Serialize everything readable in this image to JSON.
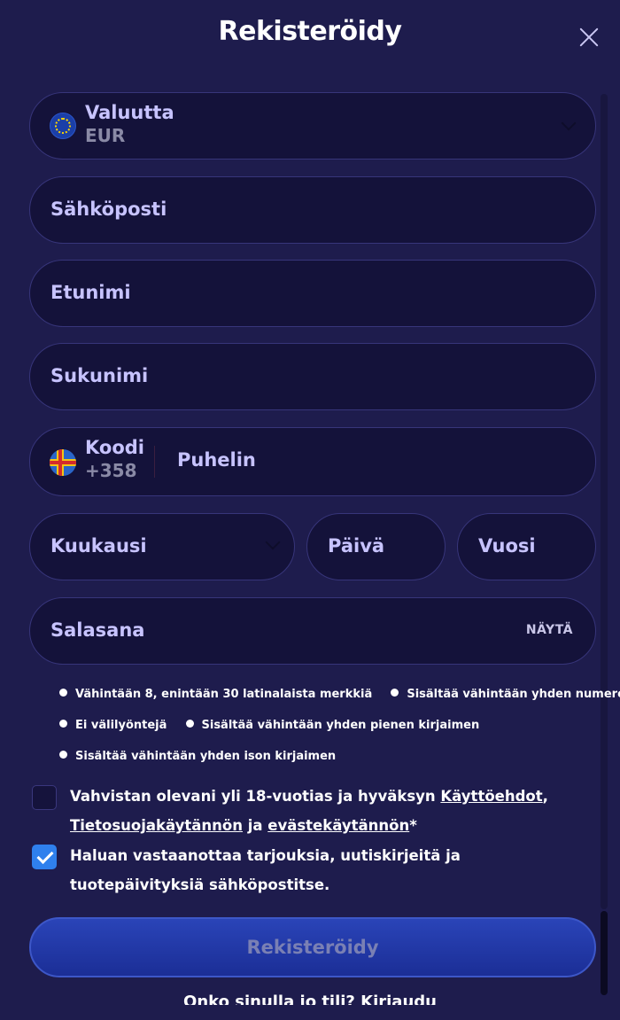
{
  "modal": {
    "title": "Rekisteröidy",
    "close_icon": "close-icon"
  },
  "currency": {
    "label": "Valuutta",
    "value": "EUR",
    "flag_icon": "eu-flag-icon"
  },
  "email": {
    "placeholder": "Sähköposti"
  },
  "first_name": {
    "placeholder": "Etunimi"
  },
  "last_name": {
    "placeholder": "Sukunimi"
  },
  "phone": {
    "code_label": "Koodi",
    "code_value": "+358",
    "flag_icon": "aland-flag-icon",
    "placeholder": "Puhelin"
  },
  "birthdate": {
    "month_placeholder": "Kuukausi",
    "day_placeholder": "Päivä",
    "year_placeholder": "Vuosi"
  },
  "password": {
    "placeholder": "Salasana",
    "show_label": "NÄYTÄ",
    "rules": [
      "Vähintään 8, enintään 30 latinalaista merkkiä",
      "Sisältää vähintään yhden numeron",
      "Ei välilyöntejä",
      "Sisältää vähintään yhden pienen kirjaimen",
      "Sisältää vähintään yhden ison kirjaimen"
    ]
  },
  "consent_terms": {
    "checked": false,
    "text_before": "Vahvistan olevani yli 18-vuotias ja hyväksyn ",
    "terms_link": "Käyttöehdot",
    "sep": ",",
    "privacy_link": "Tietosuojakäytännön",
    "and": " ja ",
    "cookie_link": "evästekäytännön",
    "suffix": "*"
  },
  "consent_marketing": {
    "checked": true,
    "text": "Haluan vastaanottaa tarjouksia, uutiskirjeitä ja tuotepäivityksiä sähköpostitse."
  },
  "register_button": {
    "label": "Rekisteröidy"
  },
  "login_prompt": {
    "text": "Onko sinulla jo tili? Kirjaudu"
  },
  "colors": {
    "background": "#1e1c4d",
    "field_bg": "#14123a",
    "field_border": "#37357a",
    "label": "#c7c3ff",
    "checkbox_checked": "#2f80ed",
    "button": "#2a44b8"
  }
}
